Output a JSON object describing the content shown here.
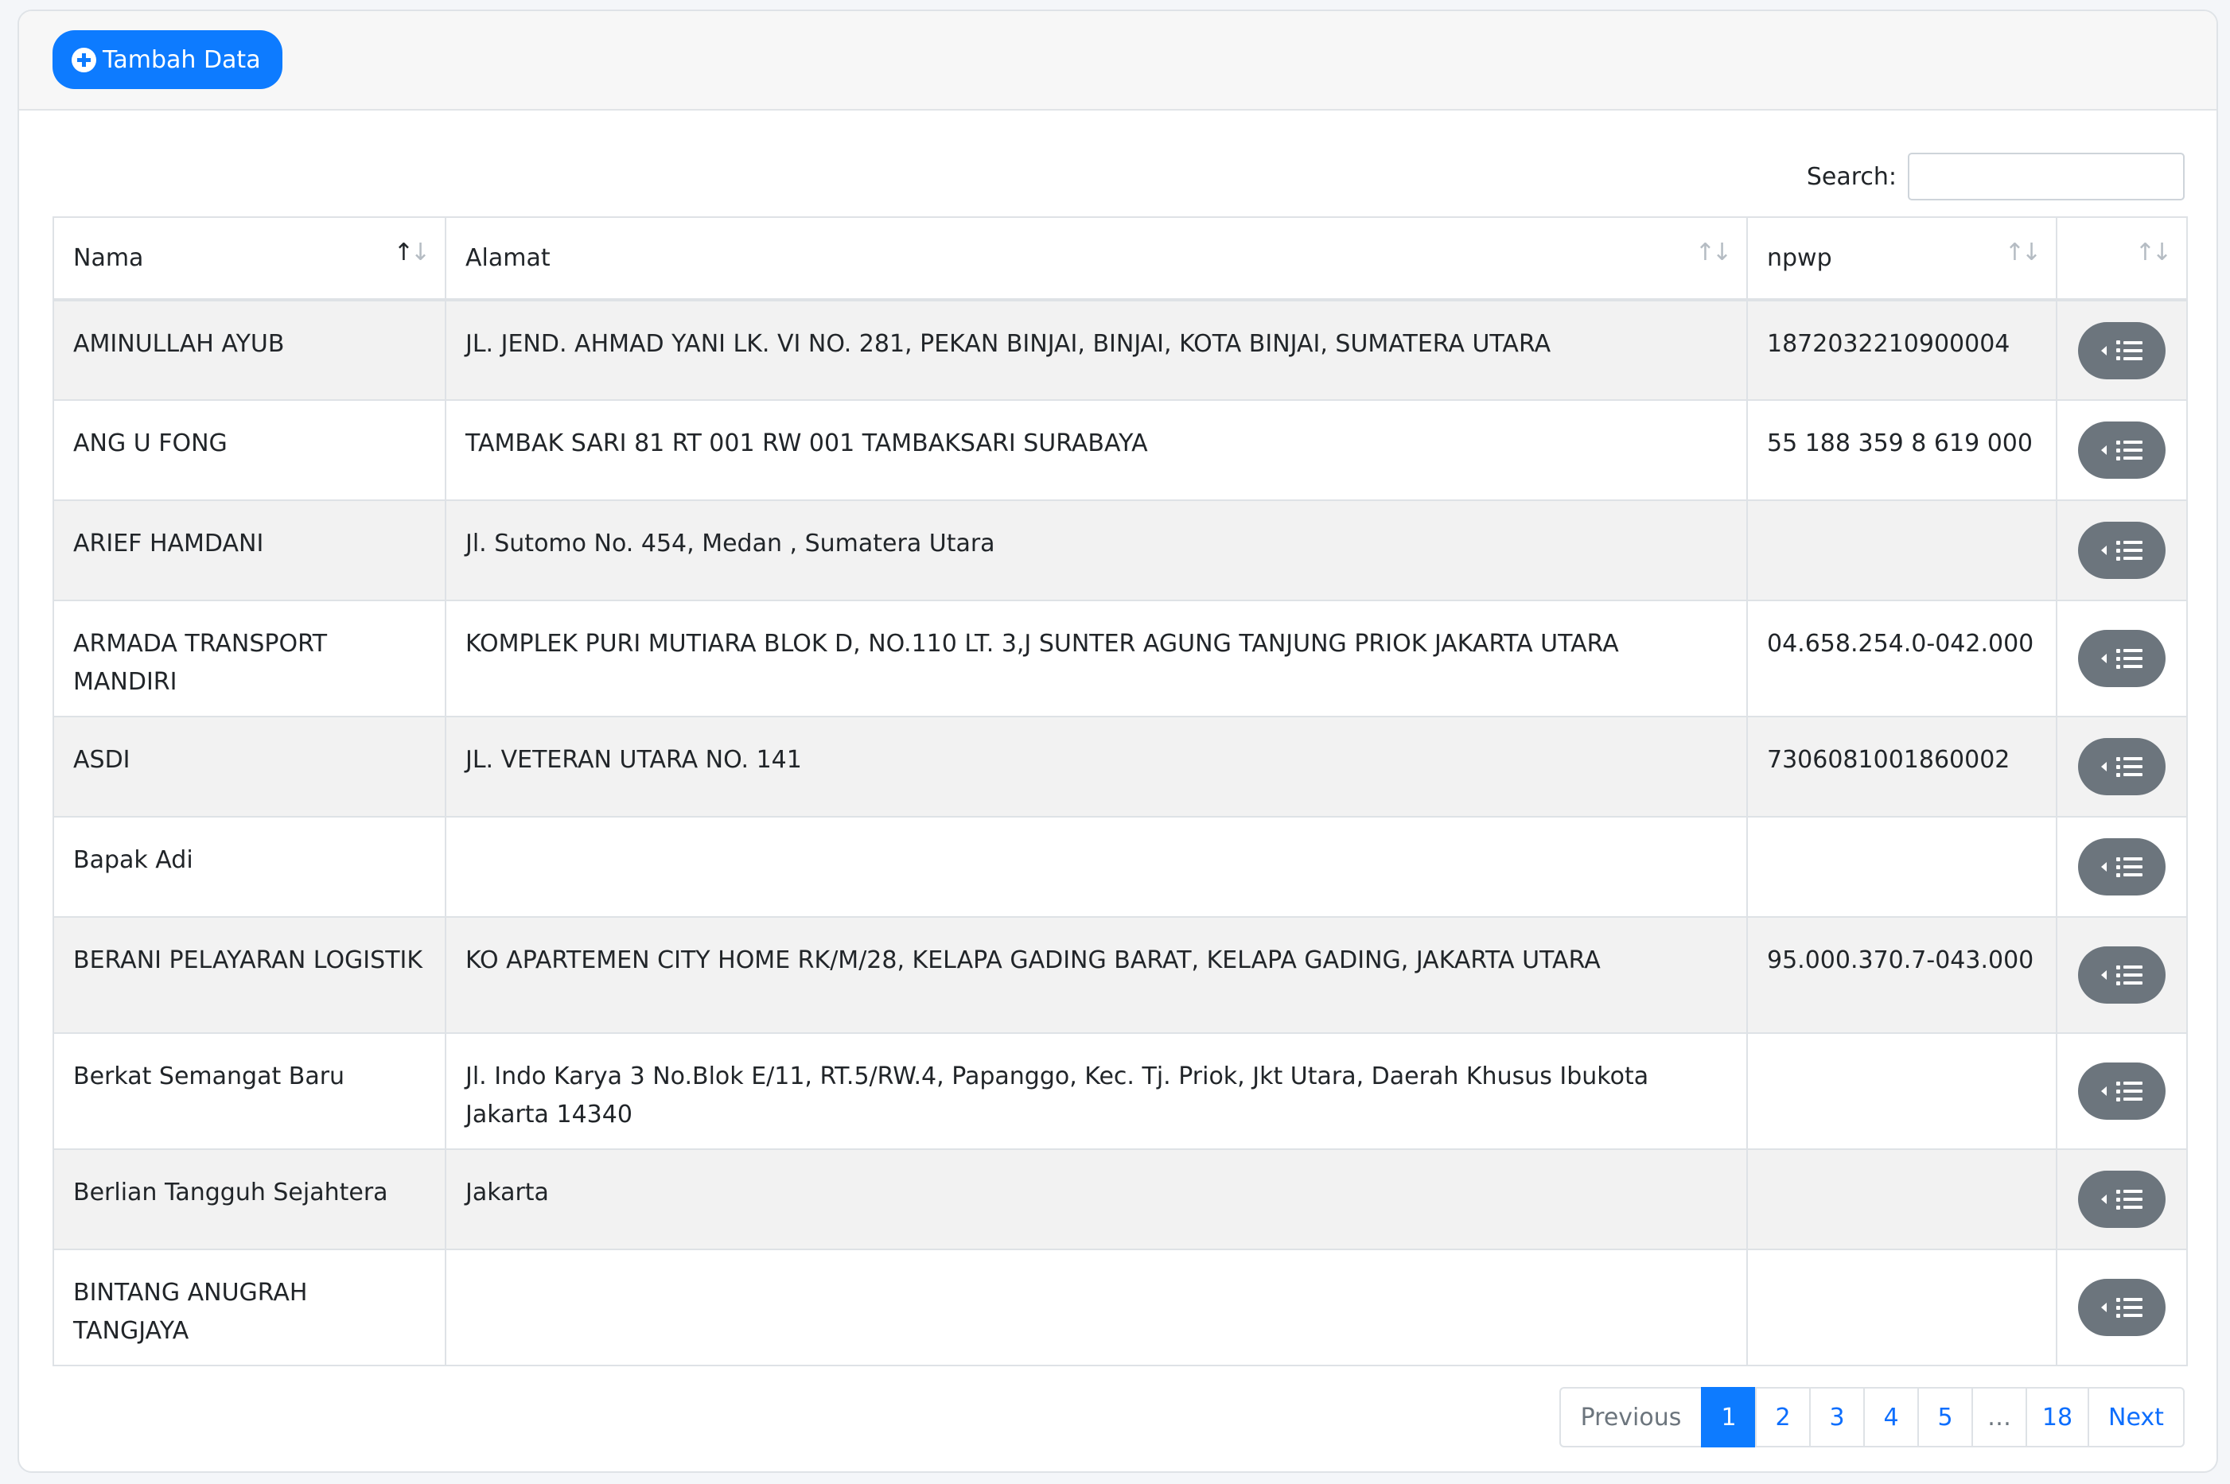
{
  "header": {
    "add_button_label": "Tambah Data"
  },
  "search": {
    "label": "Search:",
    "value": "",
    "placeholder": ""
  },
  "table": {
    "columns": [
      "Nama",
      "Alamat",
      "npwp",
      ""
    ],
    "rows": [
      {
        "nama": "AMINULLAH AYUB",
        "alamat": "JL. JEND. AHMAD YANI LK. VI NO. 281, PEKAN BINJAI, BINJAI, KOTA BINJAI, SUMATERA UTARA",
        "npwp": "1872032210900004"
      },
      {
        "nama": "ANG U FONG",
        "alamat": "TAMBAK SARI 81 RT 001 RW 001 TAMBAKSARI SURABAYA",
        "npwp": "55 188 359 8 619 000"
      },
      {
        "nama": "ARIEF HAMDANI",
        "alamat": "Jl. Sutomo No. 454, Medan , Sumatera Utara",
        "npwp": ""
      },
      {
        "nama": "ARMADA TRANSPORT MANDIRI",
        "alamat": "KOMPLEK PURI MUTIARA BLOK D, NO.110 LT. 3,J SUNTER AGUNG TANJUNG PRIOK JAKARTA UTARA",
        "npwp": "04.658.254.0-042.000"
      },
      {
        "nama": "ASDI",
        "alamat": "JL. VETERAN UTARA NO. 141",
        "npwp": "7306081001860002"
      },
      {
        "nama": "Bapak Adi",
        "alamat": "",
        "npwp": ""
      },
      {
        "nama": "BERANI PELAYARAN LOGISTIK",
        "alamat": "KO APARTEMEN CITY HOME RK/M/28, KELAPA GADING BARAT, KELAPA GADING, JAKARTA UTARA",
        "npwp": "95.000.370.7-043.000"
      },
      {
        "nama": "Berkat Semangat Baru",
        "alamat": "Jl. Indo Karya 3 No.Blok E/11, RT.5/RW.4, Papanggo, Kec. Tj. Priok, Jkt Utara, Daerah Khusus Ibukota Jakarta 14340",
        "npwp": ""
      },
      {
        "nama": "Berlian Tangguh Sejahtera",
        "alamat": "Jakarta",
        "npwp": ""
      },
      {
        "nama": "BINTANG ANUGRAH TANGJAYA",
        "alamat": "",
        "npwp": ""
      }
    ]
  },
  "pagination": {
    "previous": "Previous",
    "pages": [
      "1",
      "2",
      "3",
      "4",
      "5",
      "…",
      "18"
    ],
    "active_page": "1",
    "next": "Next"
  },
  "colors": {
    "primary": "#0d7bff",
    "action_button": "#6c757d",
    "striped_row": "#f2f2f2"
  },
  "icons": {
    "add": "plus-circle-icon",
    "action": "list-icon",
    "sort": "sort-icon"
  }
}
